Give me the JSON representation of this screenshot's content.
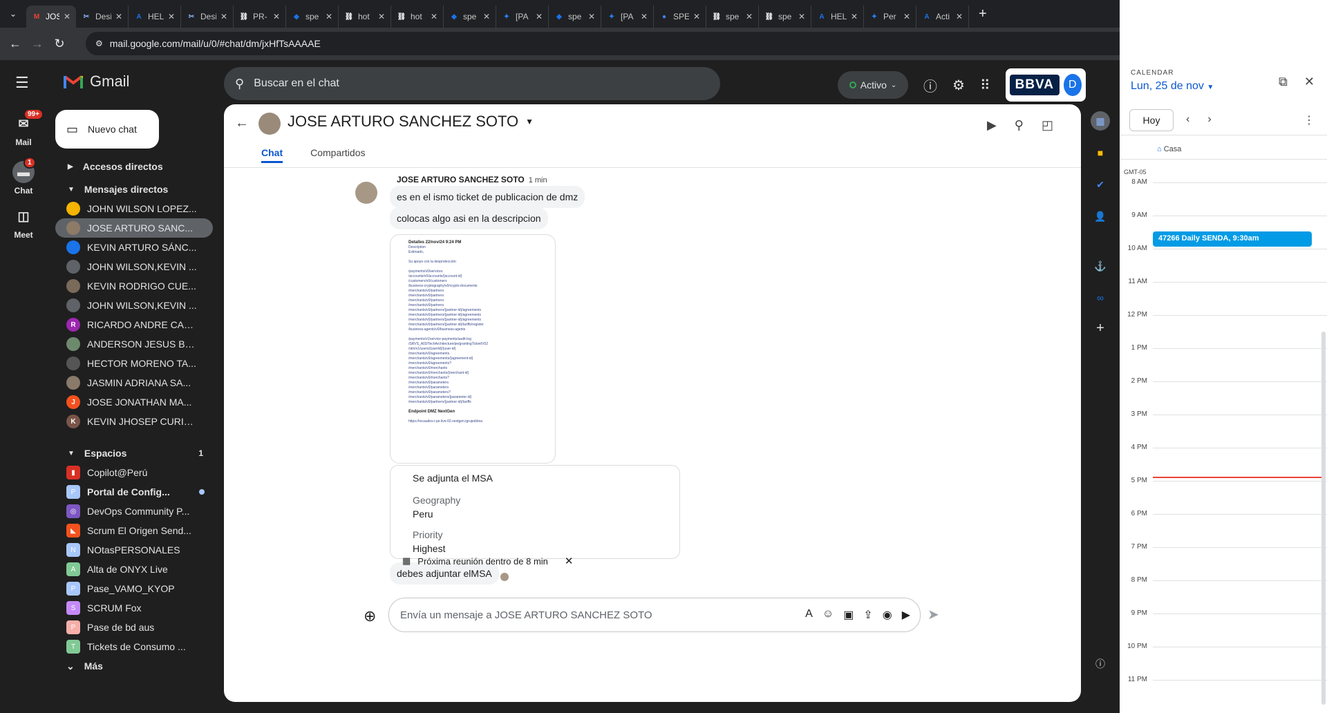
{
  "browser": {
    "tabs": [
      {
        "title": "JOS",
        "icon": "M",
        "color": "#ea4335",
        "active": true
      },
      {
        "title": "Desi",
        "icon": "✂",
        "color": "#8ab4f8"
      },
      {
        "title": "HEL",
        "icon": "A",
        "color": "#1a73e8"
      },
      {
        "title": "Desi",
        "icon": "✂",
        "color": "#8ab4f8"
      },
      {
        "title": "PR-",
        "icon": "⛓",
        "color": "#e8eaed"
      },
      {
        "title": "spe",
        "icon": "◆",
        "color": "#1a73e8"
      },
      {
        "title": "hot",
        "icon": "⛓",
        "color": "#e8eaed"
      },
      {
        "title": "hot",
        "icon": "⛓",
        "color": "#e8eaed"
      },
      {
        "title": "spe",
        "icon": "◆",
        "color": "#1a73e8"
      },
      {
        "title": "[PA",
        "icon": "✦",
        "color": "#2684ff"
      },
      {
        "title": "spe",
        "icon": "◆",
        "color": "#1a73e8"
      },
      {
        "title": "[PA",
        "icon": "✦",
        "color": "#2684ff"
      },
      {
        "title": "SPE",
        "icon": "●",
        "color": "#4285f4"
      },
      {
        "title": "spe",
        "icon": "⛓",
        "color": "#e8eaed"
      },
      {
        "title": "spe",
        "icon": "⛓",
        "color": "#e8eaed"
      },
      {
        "title": "HEL",
        "icon": "A",
        "color": "#1a73e8"
      },
      {
        "title": "Per",
        "icon": "✦",
        "color": "#2684ff"
      },
      {
        "title": "Acti",
        "icon": "A",
        "color": "#1a73e8"
      }
    ],
    "url": "mail.google.com/mail/u/0/#chat/dm/jxHfTsAAAAE",
    "profile_initial": "D"
  },
  "rail": {
    "mail_label": "Mail",
    "mail_badge": "99+",
    "chat_label": "Chat",
    "chat_badge": "1",
    "meet_label": "Meet"
  },
  "header": {
    "app_name": "Gmail",
    "search_placeholder": "Buscar en el chat",
    "status_label": "Activo",
    "brand": "BBVA",
    "user_initial": "D"
  },
  "sidebar": {
    "new_chat": "Nuevo chat",
    "shortcuts": "Accesos directos",
    "dm_header": "Mensajes directos",
    "dms": [
      {
        "name": "JOHN WILSON LOPEZ...",
        "color": "#f4b400"
      },
      {
        "name": "JOSE ARTURO SANC...",
        "color": "#8d7b68",
        "selected": true
      },
      {
        "name": "KEVIN ARTURO SÁNC...",
        "color": "#1a73e8"
      },
      {
        "name": "JOHN WILSON,KEVIN ...",
        "color": "#5f6368"
      },
      {
        "name": "KEVIN RODRIGO CUE...",
        "color": "#7a6a5a"
      },
      {
        "name": "JOHN WILSON,KEVIN ...",
        "color": "#5f6368"
      },
      {
        "name": "RICARDO ANDRE CAR...",
        "color": "#9c27b0",
        "letter": "R"
      },
      {
        "name": "ANDERSON JESUS BE...",
        "color": "#6d8a6d"
      },
      {
        "name": "HECTOR MORENO TA...",
        "color": "#555"
      },
      {
        "name": "JASMIN ADRIANA SA...",
        "color": "#8a7a6a"
      },
      {
        "name": "JOSE JONATHAN MA...",
        "color": "#f4511e",
        "letter": "J"
      },
      {
        "name": "KEVIN JHOSEP CURIÑ...",
        "color": "#795548",
        "letter": "K"
      }
    ],
    "spaces_header": "Espacios",
    "spaces_count": "1",
    "spaces": [
      {
        "name": "Copilot@Perú",
        "color": "#d93025",
        "letter": "▮"
      },
      {
        "name": "Portal de Config...",
        "color": "#a8c7fa",
        "letter": "P",
        "bold": true,
        "unread": true
      },
      {
        "name": "DevOps Community P...",
        "color": "#7e57c2",
        "letter": "◎"
      },
      {
        "name": "Scrum El Origen Send...",
        "color": "#f4511e",
        "letter": "◣"
      },
      {
        "name": "NOtasPERSONALES",
        "color": "#a8c7fa",
        "letter": "N"
      },
      {
        "name": "Alta de ONYX Live",
        "color": "#81c995",
        "letter": "A"
      },
      {
        "name": "Pase_VAMO_KYOP",
        "color": "#a8c7fa",
        "letter": "P"
      },
      {
        "name": "SCRUM Fox",
        "color": "#c58af9",
        "letter": "S"
      },
      {
        "name": "Pase de bd aus",
        "color": "#f6aea9",
        "letter": "P"
      },
      {
        "name": "Tickets de Consumo ...",
        "color": "#81c995",
        "letter": "T"
      }
    ],
    "more": "Más"
  },
  "chat": {
    "title": "JOSE ARTURO SANCHEZ SOTO",
    "tab_chat": "Chat",
    "tab_shared": "Compartidos",
    "sender": "JOSE ARTURO SANCHEZ SOTO",
    "time": "1 min",
    "msg1": "es en el ismo ticket de publicacion de dmz",
    "msg2": "colocas algo asi en la descripcion",
    "image_lines": [
      {
        "t": "Detalles   22/nov/24 9:24 PM",
        "h": true
      },
      {
        "t": "Description"
      },
      {
        "t": "Estimado,"
      },
      {
        "t": ""
      },
      {
        "t": "Su apoyo con la desprotección:"
      },
      {
        "t": ""
      },
      {
        "t": "/payments/v0/services"
      },
      {
        "t": "/accounts/v0/accounts/{account-id}"
      },
      {
        "t": "/customers/v0/customers"
      },
      {
        "t": "/business-cryptography/v0/crypto-documents"
      },
      {
        "t": "/merchants/v0/partners"
      },
      {
        "t": "/merchants/v0/partners"
      },
      {
        "t": "/merchants/v0/partners"
      },
      {
        "t": "/merchants/v0/partners"
      },
      {
        "t": "/merchants/v0/partners/{partner-id}/agreements"
      },
      {
        "t": "/merchants/v0/partners/{partner-id}/agreements"
      },
      {
        "t": "/merchants/v0/partners/{partner-id}/agreements"
      },
      {
        "t": "/merchants/v0/partners/{partner-id}/tariffs/register"
      },
      {
        "t": "/business-agents/v0/business-agents"
      },
      {
        "t": ""
      },
      {
        "t": "/payments/v1/service-payments/audit-log"
      },
      {
        "t": "/SRVS_A03/TechArchitecture/pe/grantingTicket/V02"
      },
      {
        "t": "/stm/v1/users/{userId}/{user-id}"
      },
      {
        "t": "/merchants/v0/agreements"
      },
      {
        "t": "/merchants/v0/agreements/{agreement-id}"
      },
      {
        "t": "/merchants/v0/agreements?"
      },
      {
        "t": "/merchants/v0/merchants"
      },
      {
        "t": "/merchants/v0/merchants/{merchant-id}"
      },
      {
        "t": "/merchants/v0/merchants?"
      },
      {
        "t": "/merchants/v0/parameters"
      },
      {
        "t": "/merchants/v0/parameters"
      },
      {
        "t": "/merchants/v0/parameters?"
      },
      {
        "t": "/merchants/v0/parameters/{parameter-id}"
      },
      {
        "t": "/merchants/v0/partners/{partner-id}/tariffs"
      },
      {
        "t": ""
      },
      {
        "t": "Endpoint DMZ NextGen",
        "h": true
      },
      {
        "t": ""
      },
      {
        "t": "https://recaudos-i-pe.live-02.nextgen.igrupobbva"
      }
    ],
    "card_title": "Se adjunta el MSA",
    "geo_label": "Geography",
    "geo_value": "Peru",
    "prio_label": "Priority",
    "prio_value": "Highest",
    "msg3": "debes adjuntar elMSA",
    "meeting": "Próxima reunión dentro de 8 min",
    "composer_placeholder": "Envía un mensaje a JOSE ARTURO SANCHEZ SOTO"
  },
  "calendar": {
    "label": "CALENDAR",
    "date": "Lun, 25 de nov",
    "today": "Hoy",
    "allday": "Casa",
    "tz": "GMT-05",
    "hours": [
      "8 AM",
      "9 AM",
      "10 AM",
      "11 AM",
      "12 PM",
      "1 PM",
      "2 PM",
      "3 PM",
      "4 PM",
      "5 PM",
      "6 PM",
      "7 PM",
      "8 PM",
      "9 PM",
      "10 PM",
      "11 PM"
    ],
    "event": "47266 Daily SENDA, 9:30am"
  }
}
